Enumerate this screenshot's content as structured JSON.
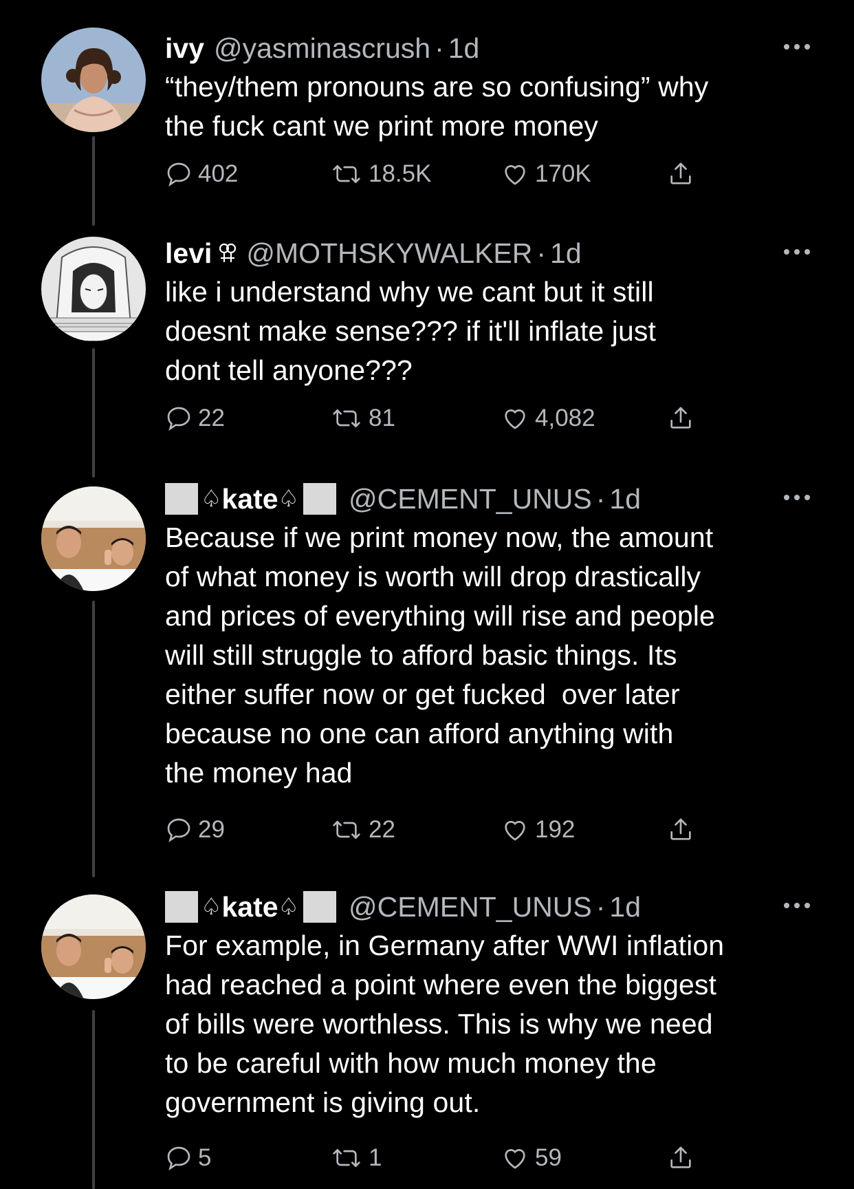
{
  "tweets": [
    {
      "name": "ivy",
      "handle": "@yasminascrush",
      "dot": "·",
      "time": "1d",
      "text": "“they/them pronouns are so confusing” why\nthe fuck cant we print more money",
      "replies": "402",
      "retweets": "18.5K",
      "likes": "170K"
    },
    {
      "name": "levi",
      "name_icon": "female-female-symbol-icon",
      "handle": "@MOTHSKYWALKER",
      "dot": "·",
      "time": "1d",
      "text": "like i understand why we cant but it still\ndoesnt make sense??? if it'll inflate just\ndont tell anyone???",
      "replies": "22",
      "retweets": "81",
      "likes": "4,082"
    },
    {
      "name": "kate",
      "name_prefix": "♤",
      "name_suffix": "♤",
      "handle": "@CEMENT_UNUS",
      "dot": "·",
      "time": "1d",
      "text": "Because if we print money now, the amount\nof what money is worth will drop drastically\nand prices of everything will rise and people\nwill still struggle to afford basic things. Its\neither suffer now or get fucked  over later\nbecause no one can afford anything with\nthe money had",
      "replies": "29",
      "retweets": "22",
      "likes": "192"
    },
    {
      "name": "kate",
      "name_prefix": "♤",
      "name_suffix": "♤",
      "handle": "@CEMENT_UNUS",
      "dot": "·",
      "time": "1d",
      "text": "For example, in Germany after WWI inflation\nhad reached a point where even the biggest\nof bills were worthless. This is why we need\nto be careful with how much money the\ngovernment is giving out.",
      "replies": "5",
      "retweets": "1",
      "likes": "59"
    }
  ],
  "icons": {
    "reply": "reply-icon",
    "retweet": "retweet-icon",
    "like": "heart-icon",
    "share": "share-icon",
    "more": "more-options-icon"
  },
  "colors": {
    "background": "#000000",
    "text": "#ffffff",
    "secondary": "#b4b8bc",
    "thread_line": "#3e4144"
  }
}
